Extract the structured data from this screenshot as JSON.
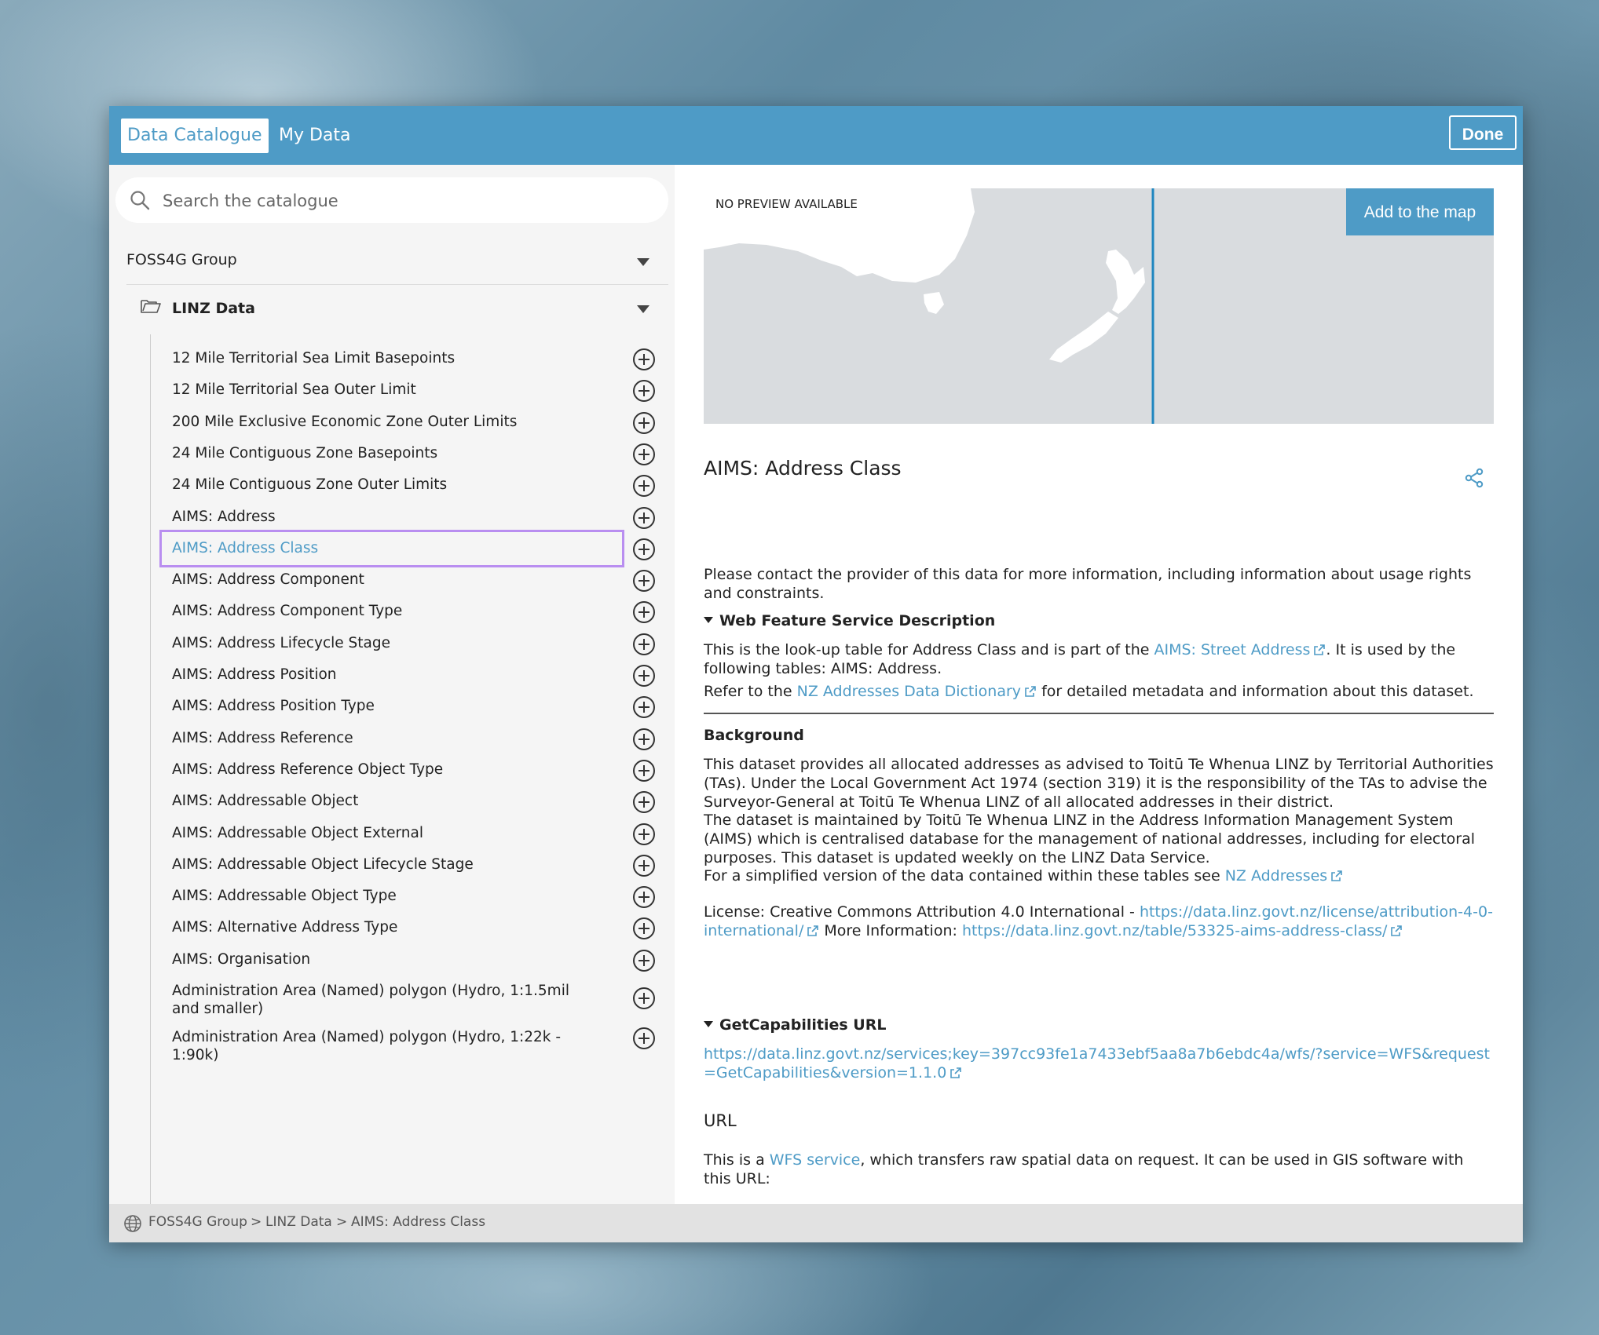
{
  "header": {
    "tabs": [
      {
        "label": "Data Catalogue"
      },
      {
        "label": "My Data"
      }
    ],
    "done_label": "Done"
  },
  "search": {
    "placeholder": "Search the catalogue",
    "value": ""
  },
  "catalogue": {
    "group": "FOSS4G Group",
    "folder": "LINZ Data",
    "items": [
      "12 Mile Territorial Sea Limit Basepoints",
      "12 Mile Territorial Sea Outer Limit",
      "200 Mile Exclusive Economic Zone Outer Limits",
      "24 Mile Contiguous Zone Basepoints",
      "24 Mile Contiguous Zone Outer Limits",
      "AIMS: Address",
      "AIMS: Address Class",
      "AIMS: Address Component",
      "AIMS: Address Component Type",
      "AIMS: Address Lifecycle Stage",
      "AIMS: Address Position",
      "AIMS: Address Position Type",
      "AIMS: Address Reference",
      "AIMS: Address Reference Object Type",
      "AIMS: Addressable Object",
      "AIMS: Addressable Object External",
      "AIMS: Addressable Object Lifecycle Stage",
      "AIMS: Addressable Object Type",
      "AIMS: Alternative Address Type",
      "AIMS: Organisation",
      "Administration Area (Named) polygon (Hydro, 1:1.5mil and smaller)",
      "Administration Area (Named) polygon (Hydro, 1:22k - 1:90k)"
    ],
    "selected_index": 6
  },
  "detail": {
    "no_preview": "NO PREVIEW AVAILABLE",
    "add_button": "Add to the map",
    "title": "AIMS: Address Class",
    "contact_text": "Please contact the provider of this data for more information, including information about usage rights and constraints.",
    "wfs_heading": "Web Feature Service Description",
    "wfs_p1_a": "This is the look-up table for Address Class and is part of the ",
    "wfs_p1_link": "AIMS: Street Address",
    "wfs_p1_b": ". It is used by the following tables: AIMS: Address.",
    "wfs_p2_a": "Refer to the ",
    "wfs_p2_link": "NZ Addresses Data Dictionary",
    "wfs_p2_b": " for detailed metadata and information about this dataset.",
    "background_heading": "Background",
    "bg_p1": "This dataset provides all allocated addresses as advised to Toitū Te Whenua LINZ by Territorial Authorities (TAs). Under the Local Government Act 1974 (section 319) it is the responsibility of the TAs to advise the Surveyor-General at Toitū Te Whenua LINZ of all allocated addresses in their district.",
    "bg_p2": "The dataset is maintained by Toitū Te Whenua LINZ in the Address Information Management System (AIMS) which is centralised database for the management of national addresses, including for electoral purposes. This dataset is updated weekly on the LINZ Data Service.",
    "bg_p3_a": "For a simplified version of the data contained within these tables see ",
    "bg_p3_link": "NZ Addresses",
    "license_a": "License: Creative Commons Attribution 4.0 International - ",
    "license_link": "https://data.linz.govt.nz/license/attribution-4-0-international/",
    "more_info_a": " More Information: ",
    "more_info_link": "https://data.linz.govt.nz/table/53325-aims-address-class/",
    "getcap_heading": "GetCapabilities URL",
    "getcap_link": "https://data.linz.govt.nz/services;key=397cc93fe1a7433ebf5aa8a7b6ebdc4a/wfs/?service=WFS&request=GetCapabilities&version=1.1.0",
    "url_heading": "URL",
    "url_p_a": "This is a ",
    "url_p_link": "WFS service",
    "url_p_b": ", which transfers raw spatial data on request. It can be used in GIS software with this URL:"
  },
  "breadcrumb": [
    "FOSS4G Group",
    "LINZ Data",
    "AIMS: Address Class"
  ],
  "icons": {
    "search": "search-icon",
    "folder": "folder-open-icon",
    "add": "plus-circle-icon",
    "share": "share-icon",
    "external": "external-link-icon",
    "globe": "globe-icon"
  },
  "colors": {
    "accent": "#4e9bc6",
    "selection_outline": "#b98ef0"
  }
}
